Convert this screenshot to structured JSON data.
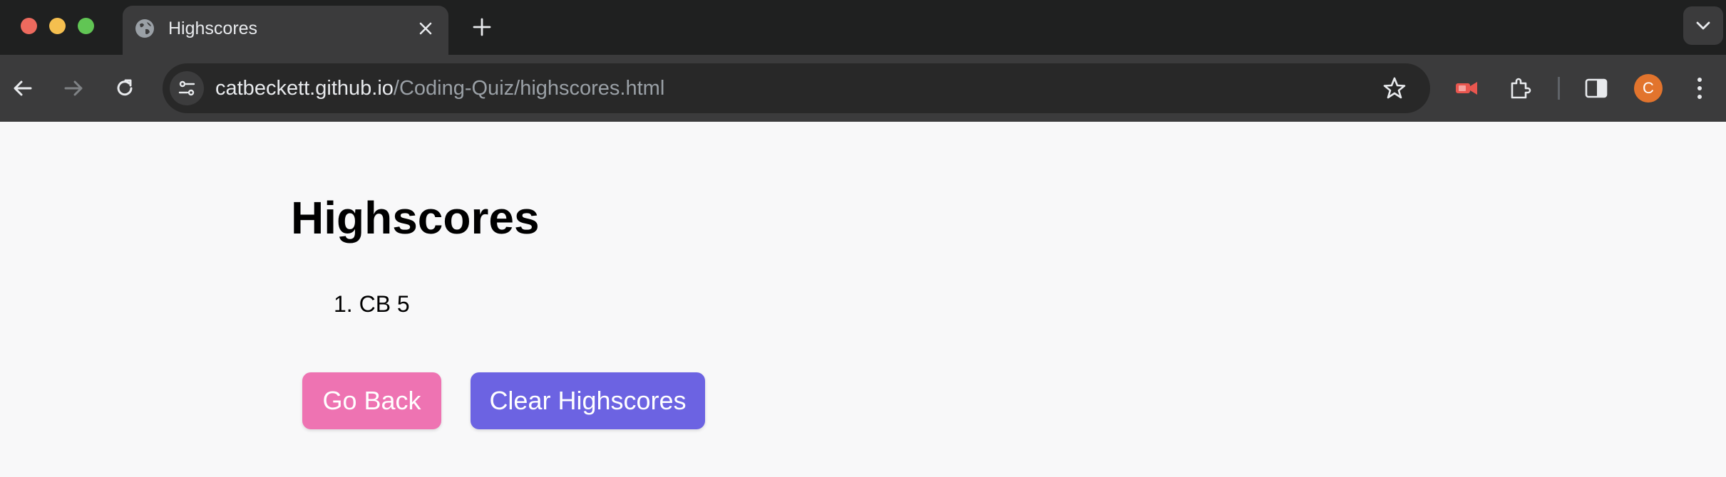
{
  "browser": {
    "tab": {
      "title": "Highscores",
      "favicon": "globe-icon"
    },
    "url": {
      "host": "catbeckett.github.io",
      "path": "/Coding-Quiz/highscores.html"
    },
    "avatar_letter": "C",
    "colors": {
      "frame": "#1f2020",
      "toolbar": "#3b3b3c",
      "omnibox": "#282828",
      "avatar": "#e2742d"
    }
  },
  "page": {
    "title": "Highscores",
    "scores": [
      {
        "text": "1. CB 5"
      }
    ],
    "buttons": {
      "back_label": "Go Back",
      "clear_label": "Clear Highscores"
    },
    "colors": {
      "back_button": "#ee73b2",
      "clear_button": "#6c63e2",
      "background": "#f8f8f9"
    }
  }
}
